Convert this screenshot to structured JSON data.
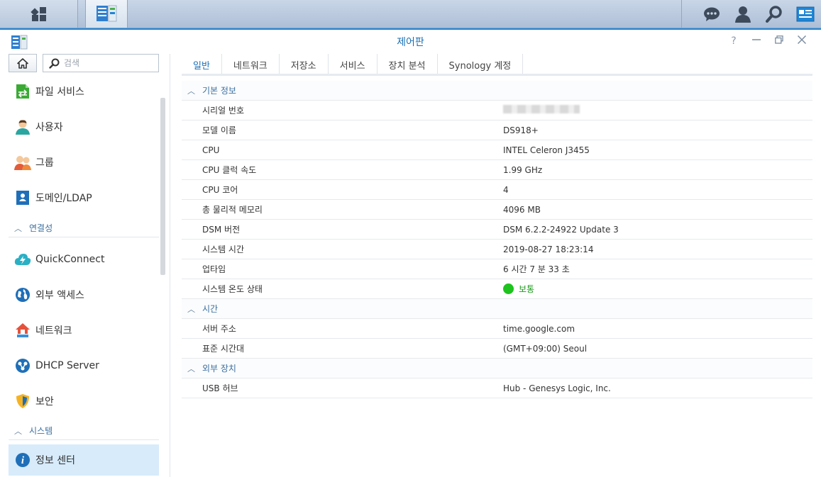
{
  "window": {
    "title": "제어판"
  },
  "search": {
    "placeholder": "검색"
  },
  "sidebar": {
    "items": [
      {
        "label": "파일 서비스",
        "icon": "file-services-icon"
      },
      {
        "label": "사용자",
        "icon": "user-icon"
      },
      {
        "label": "그룹",
        "icon": "group-icon"
      },
      {
        "label": "도메인/LDAP",
        "icon": "domain-ldap-icon"
      }
    ],
    "groups": [
      {
        "label": "연결성",
        "items": [
          {
            "label": "QuickConnect",
            "icon": "quickconnect-icon"
          },
          {
            "label": "외부 액세스",
            "icon": "external-access-icon"
          },
          {
            "label": "네트워크",
            "icon": "network-icon"
          },
          {
            "label": "DHCP Server",
            "icon": "dhcp-server-icon"
          },
          {
            "label": "보안",
            "icon": "security-icon"
          }
        ]
      },
      {
        "label": "시스템",
        "items": [
          {
            "label": "정보 센터",
            "icon": "info-center-icon",
            "active": true
          }
        ]
      }
    ]
  },
  "tabs": [
    "일반",
    "네트워크",
    "저장소",
    "서비스",
    "장치 분석",
    "Synology 계정"
  ],
  "sections": [
    {
      "title": "기본 정보",
      "rows": [
        {
          "key": "시리얼 번호",
          "value": ""
        },
        {
          "key": "모델 이름",
          "value": "DS918+"
        },
        {
          "key": "CPU",
          "value": "INTEL Celeron J3455"
        },
        {
          "key": "CPU 클럭 속도",
          "value": "1.99 GHz"
        },
        {
          "key": "CPU 코어",
          "value": "4"
        },
        {
          "key": "총 물리적 메모리",
          "value": "4096 MB"
        },
        {
          "key": "DSM 버전",
          "value": "DSM 6.2.2-24922 Update 3"
        },
        {
          "key": "시스템 시간",
          "value": "2019-08-27 18:23:14"
        },
        {
          "key": "업타임",
          "value": "6 시간 7 분 33 초"
        },
        {
          "key": "시스템 온도 상태",
          "value": "보통"
        }
      ]
    },
    {
      "title": "시간",
      "rows": [
        {
          "key": "서버 주소",
          "value": "time.google.com"
        },
        {
          "key": "표준 시간대",
          "value": "(GMT+09:00) Seoul"
        }
      ]
    },
    {
      "title": "외부 장치",
      "rows": [
        {
          "key": "USB 허브",
          "value": "Hub - Genesys Logic, Inc."
        }
      ]
    }
  ],
  "colors": {
    "accent": "#1f86d6",
    "status_ok": "#1ec31e"
  }
}
